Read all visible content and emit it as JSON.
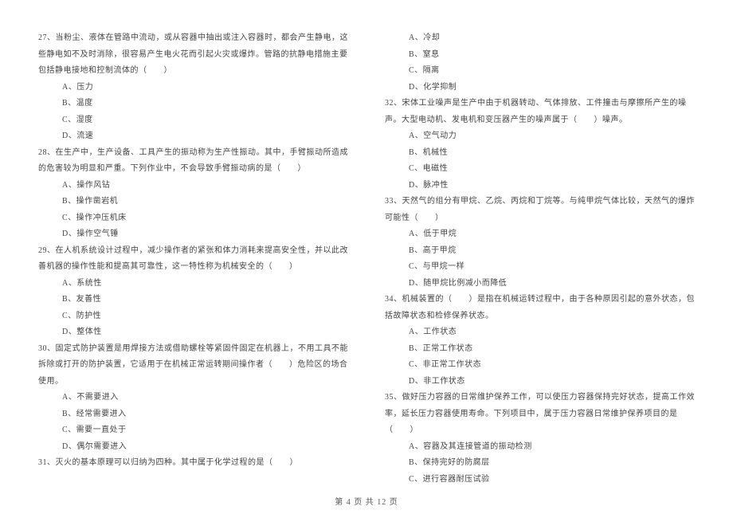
{
  "left_column": {
    "q27": {
      "text": "27、当粉尘、液体在管路中流动，或从容器中抽出或注入容器时，都会产生静电，这些静电如不及时消除，很容易产生电火花而引起火灾或爆炸。管路的抗静电措施主要包括静电接地和控制流体的（　　）",
      "a": "A、压力",
      "b": "B、温度",
      "c": "C、湿度",
      "d": "D、流速"
    },
    "q28": {
      "text": "28、在生产中，生产设备、工具产生的振动称为生产性振动。其中，手臂振动所造成的危害较为明显和严重。下列作业中，不会导致手臂振动病的是（　　）",
      "a": "A、操作风钻",
      "b": "B、操作凿岩机",
      "c": "C、操作冲压机床",
      "d": "D、操作空气锤"
    },
    "q29": {
      "text": "29、在人机系统设计过程中，减少操作者的紧张和体力消耗来提高安全性，并以此改善机器的操作性能和提高其可靠性，这一特性称为机械安全的（　　）",
      "a": "A、系统性",
      "b": "B、友善性",
      "c": "C、防护性",
      "d": "D、整体性"
    },
    "q30": {
      "text": "30、固定式防护装置是用焊接方法或借助螺栓等紧固件固定在机器上，不用工具不能拆除或打开的防护装置，它适用于在机械正常运转期间操作者（　　）危险区的场合使用。",
      "a": "A、不需要进入",
      "b": "B、经常需要进入",
      "c": "C、需要一直处于",
      "d": "D、偶尔需要进入"
    },
    "q31": {
      "text": "31、灭火的基本原理可以归纳为四种。其中属于化学过程的是（　　）"
    }
  },
  "right_column": {
    "q31_options": {
      "a": "A、冷却",
      "b": "B、窒息",
      "c": "C、隔离",
      "d": "D、化学抑制"
    },
    "q32": {
      "text": "32、宋体工业噪声是生产中由于机器转动、气体排放、工件撞击与摩擦所产生的噪声。大型电动机、发电机和变压器产生的噪声属于（　　）噪声。",
      "a": "A、空气动力",
      "b": "B、机械性",
      "c": "C、电磁性",
      "d": "D、脉冲性"
    },
    "q33": {
      "text": "33、天然气的组分有甲烷、乙烷、丙烷和丁烷等。与纯甲烷气体比较，天然气的爆炸可能性（　　）",
      "a": "A、低于甲烷",
      "b": "B、高于甲烷",
      "c": "C、与甲烷一样",
      "d": "D、随甲烷比例减小而降低"
    },
    "q34": {
      "text": "34、机械装置的（　　）是指在机械运转过程中，由于各种原因引起的意外状态，包括故障状态和检修保养状态。",
      "a": "A、工作状态",
      "b": "B、正常工作状态",
      "c": "C、非正常工作状态",
      "d": "D、非工作状态"
    },
    "q35": {
      "text": "35、做好压力容器的日常维护保养工作，可以使压力容器保持完好状态，提高工作效率，延长压力容器使用寿命。下列项目中，属于压力容器日常维护保养项目的是（　　）",
      "a": "A、容器及其连接管道的振动检测",
      "b": "B、保持完好的防腐层",
      "c": "C、进行容器耐压试验"
    }
  },
  "footer": {
    "text": "第 4 页 共 12 页"
  }
}
